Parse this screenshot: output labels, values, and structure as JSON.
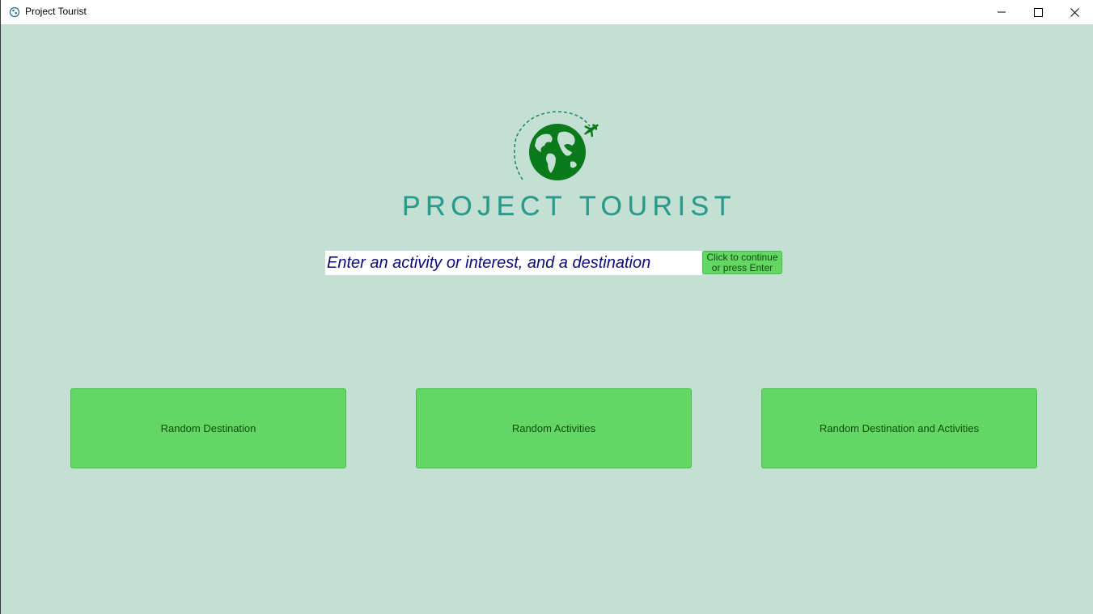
{
  "window": {
    "title": "Project Tourist",
    "icon": "globe-icon",
    "controls": [
      "minimize-icon",
      "maximize-icon",
      "close-icon"
    ]
  },
  "logo": {
    "text": "PROJECT TOURIST",
    "icon": "globe-airplane-icon"
  },
  "search": {
    "placeholder": "Enter an activity or interest, and a destination",
    "value": ""
  },
  "continue_button": {
    "label": "Click to continue\nor press Enter"
  },
  "actions": [
    {
      "label": "Random Destination"
    },
    {
      "label": "Random Activities"
    },
    {
      "label": "Random Destination and Activities"
    }
  ],
  "colors": {
    "background": "#c4e0d4",
    "button": "#63d663",
    "logo_green": "#0a7a1a",
    "logo_text": "#2a9a8a",
    "input_text": "#0b0b7a"
  }
}
